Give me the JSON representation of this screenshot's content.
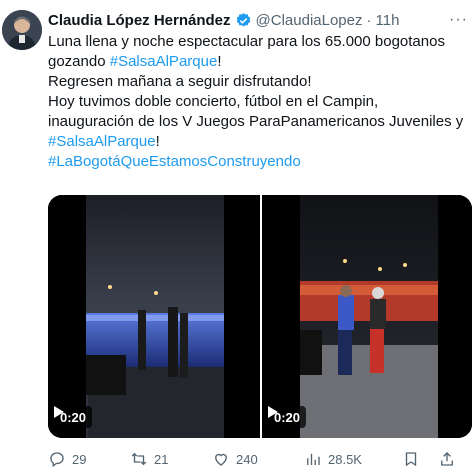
{
  "author": {
    "display_name": "Claudia López Hernández",
    "handle": "@ClaudiaLopez",
    "separator": "·",
    "time": "11h"
  },
  "tweet": {
    "line1": "Luna llena y noche espectacular para los 65.000 bogotanos gozando",
    "hashtag1": "#SalsaAlParque",
    "hashtag1_suffix": "!",
    "line2": "Regresen mañana a seguir disfrutando!",
    "line3": "Hoy tuvimos doble concierto, fútbol en el Campin, inauguración de los V Juegos ParaPanamericanos Juveniles y",
    "hashtag2": "#SalsaAlParque",
    "hashtag2_suffix": "!",
    "hashtag3": "#LaBogotáQueEstamosConstruyendo"
  },
  "media": {
    "videos": [
      {
        "duration": "0:20"
      },
      {
        "duration": "0:20"
      }
    ]
  },
  "actions": {
    "replies": "29",
    "reposts": "21",
    "likes": "240",
    "views": "28.5K"
  },
  "colors": {
    "link": "#1d9bf0",
    "muted": "#536471"
  }
}
